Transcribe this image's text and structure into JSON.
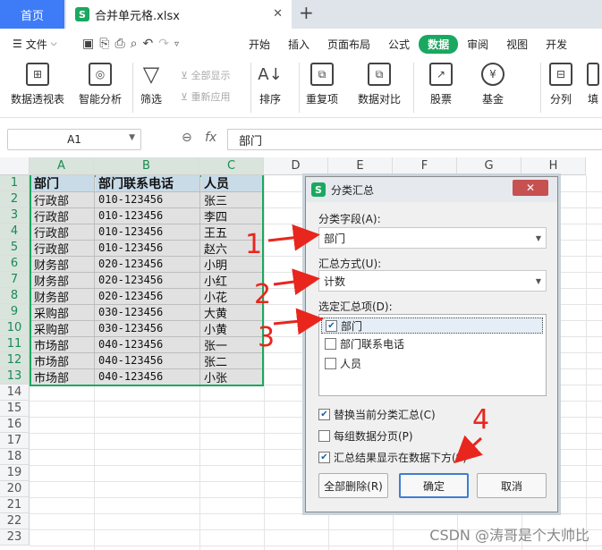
{
  "titlebar": {
    "home_tab": "首页",
    "file_tab": "合并单元格.xlsx",
    "app_logo": "S"
  },
  "menubar": {
    "file_label": "文件",
    "tabs": [
      "开始",
      "插入",
      "页面布局",
      "公式",
      "数据",
      "审阅",
      "视图",
      "开发"
    ],
    "active_tab": "数据"
  },
  "ribbon": {
    "pivot": "数据透视表",
    "smart": "智能分析",
    "filter": "筛选",
    "show_all": "全部显示",
    "reapply": "重新应用",
    "sort": "排序",
    "duplicates": "重复项",
    "compare": "数据对比",
    "stocks": "股票",
    "funds": "基金",
    "split": "分列",
    "fill": "填"
  },
  "formula_bar": {
    "name_box": "A1",
    "fx_label": "fx",
    "formula": "部门"
  },
  "sheet": {
    "columns": [
      "A",
      "B",
      "C",
      "D",
      "E",
      "F",
      "G",
      "H"
    ],
    "rows": [
      "1",
      "2",
      "3",
      "4",
      "5",
      "6",
      "7",
      "8",
      "9",
      "10",
      "11",
      "12",
      "13",
      "14",
      "15",
      "16",
      "17",
      "18",
      "19",
      "20",
      "21",
      "22",
      "23"
    ],
    "headers": [
      "部门",
      "部门联系电话",
      "人员"
    ],
    "data": [
      [
        "行政部",
        "010-123456",
        "张三"
      ],
      [
        "行政部",
        "010-123456",
        "李四"
      ],
      [
        "行政部",
        "010-123456",
        "王五"
      ],
      [
        "行政部",
        "010-123456",
        "赵六"
      ],
      [
        "财务部",
        "020-123456",
        "小明"
      ],
      [
        "财务部",
        "020-123456",
        "小红"
      ],
      [
        "财务部",
        "020-123456",
        "小花"
      ],
      [
        "采购部",
        "030-123456",
        "大黄"
      ],
      [
        "采购部",
        "030-123456",
        "小黄"
      ],
      [
        "市场部",
        "040-123456",
        "张一"
      ],
      [
        "市场部",
        "040-123456",
        "张二"
      ],
      [
        "市场部",
        "040-123456",
        "小张"
      ]
    ]
  },
  "dialog": {
    "title": "分类汇总",
    "group_by_label": "分类字段(A):",
    "group_by_value": "部门",
    "function_label": "汇总方式(U):",
    "function_value": "计数",
    "subtotal_label": "选定汇总项(D):",
    "subtotal_items": [
      {
        "label": "部门",
        "checked": true
      },
      {
        "label": "部门联系电话",
        "checked": false
      },
      {
        "label": "人员",
        "checked": false
      }
    ],
    "replace_current": "替换当前分类汇总(C)",
    "page_break": "每组数据分页(P)",
    "summary_below": "汇总结果显示在数据下方(S)",
    "remove_all": "全部删除(R)",
    "ok": "确定",
    "cancel": "取消"
  },
  "annotations": {
    "n1": "1",
    "n2": "2",
    "n3": "3",
    "n4": "4"
  },
  "watermark": "CSDN @涛哥是个大帅比",
  "colors": {
    "accent": "#1aa860",
    "annotation": "#e8261e",
    "tab_blue": "#3e7bf6"
  }
}
